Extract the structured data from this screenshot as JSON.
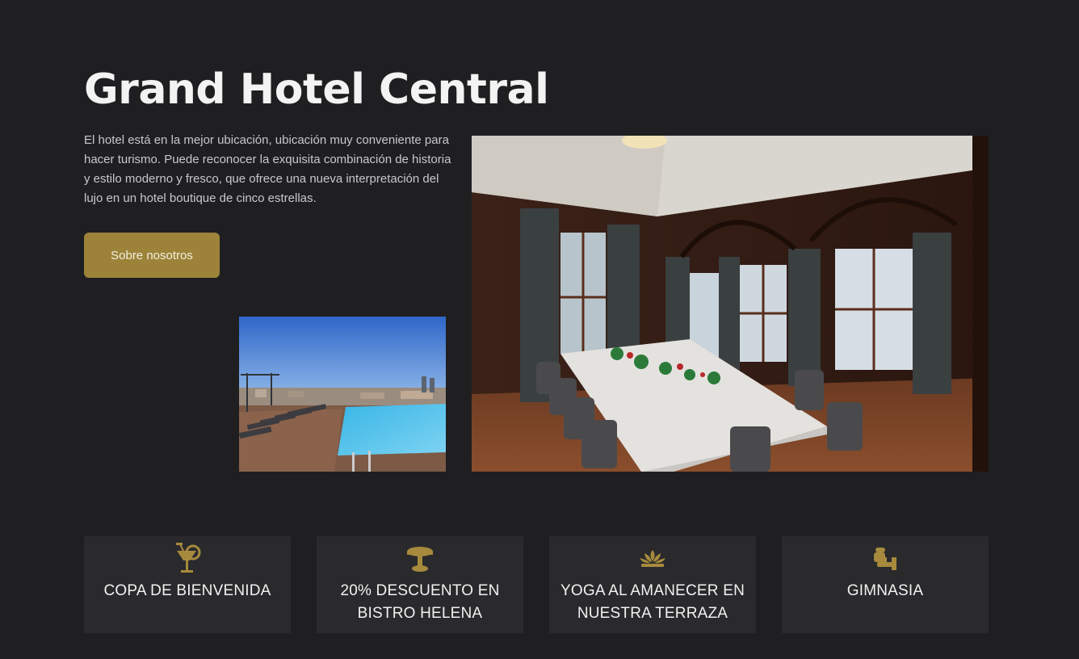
{
  "hero": {
    "title": "Grand Hotel Central",
    "description": "El hotel está en la mejor ubicación, ubicación muy conveniente para hacer turismo. Puede reconocer la exquisita combinación de historia y estilo moderno y fresco, que ofrece una nueva interpretación del lujo en un hotel boutique de cinco estrellas.",
    "button_label": "Sobre nosotros"
  },
  "images": {
    "pool": "rooftop-pool-photo",
    "dining": "dining-room-photo"
  },
  "amenities": [
    {
      "icon": "cocktail-icon",
      "label": "COPA DE BIENVENIDA"
    },
    {
      "icon": "bistro-table-icon",
      "label": "20% DESCUENTO EN BISTRO HELENA"
    },
    {
      "icon": "lotus-icon",
      "label": "YOGA AL AMANECER EN NUESTRA TERRAZA"
    },
    {
      "icon": "gym-icon",
      "label": "GIMNASIA"
    }
  ],
  "colors": {
    "background": "#1f1f21",
    "card": "#2a2a2d",
    "accent": "#9c8339",
    "text": "#ffffff"
  }
}
